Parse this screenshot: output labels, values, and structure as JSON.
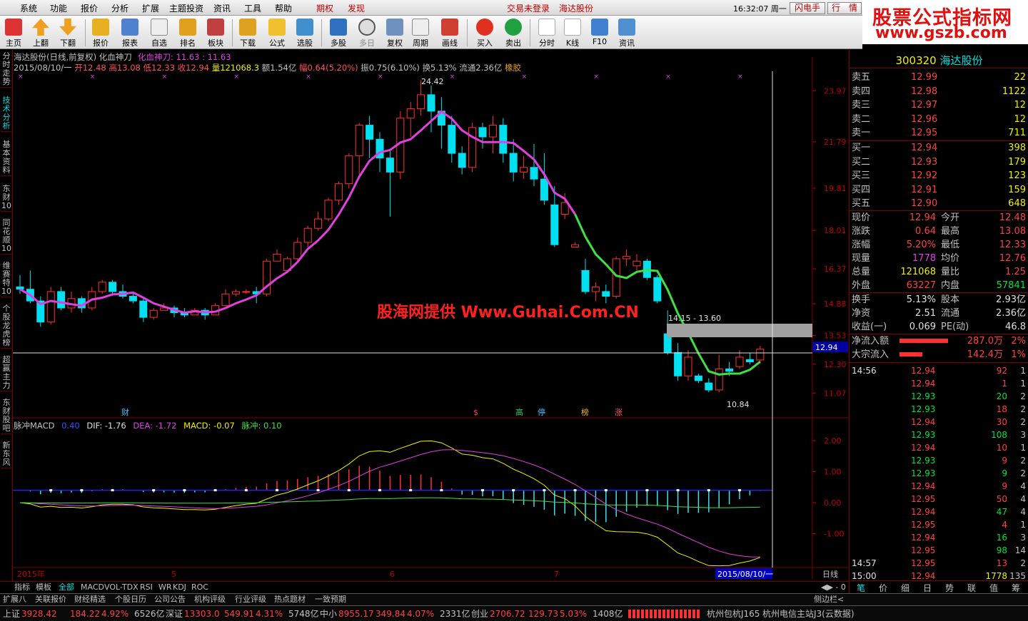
{
  "menu": {
    "items": [
      "系统",
      "功能",
      "报价",
      "分析",
      "扩展",
      "主题投资",
      "资讯",
      "工具",
      "帮助"
    ],
    "tags": [
      "期权",
      "发现"
    ],
    "center1": "交易未登录",
    "center2": "海达股份",
    "time": "16:32:07 周一",
    "btn1": "闪电手",
    "btn2": "行　情"
  },
  "brand": {
    "line1": "股票公式指标网",
    "line2": "www.gszb.com"
  },
  "toolbar": [
    "主页",
    "上翻",
    "下翻",
    "报价",
    "报表",
    "自选",
    "排名",
    "板块",
    "下载",
    "公式",
    "选股",
    "多股",
    "多日",
    "复权",
    "周期",
    "画线",
    "买入",
    "卖出",
    "分时",
    "K线",
    "F10",
    "资讯"
  ],
  "sidetabs": [
    "分时走势",
    "技术分析",
    "基本资料",
    "东财10",
    "同花顺10",
    "维赛特10",
    "个股龙虎榜",
    "超赢主力",
    "东财股吧",
    "新东风"
  ],
  "chart": {
    "title": "海达股份(日线,前复权) 化血神刀",
    "indicator": "化血神刀: 11.63 : 11.63",
    "info": {
      "date": "2015/08/10/一",
      "open": "开12.48",
      "high": "高13.08",
      "low": "低12.33",
      "close": "收12.94",
      "vol": "量121068.3",
      "amt": "额1.54亿",
      "pct": "幅0.64(5.20%)",
      "amp": "振0.75(6.10%)",
      "turn": "换5.13%",
      "float": "流通2.36亿",
      "label": "橡胶"
    },
    "yticks": [
      "23.97",
      "21.79",
      "19.81",
      "18.01",
      "16.37",
      "14.88",
      "13.53",
      "12.30",
      "11.07"
    ],
    "high_label": "24.42",
    "low_label": "10.84",
    "range_label": "14.15 - 13.60",
    "price_label": "12.94",
    "watermark": "股海网提供 Www.Guhai.Com.CN",
    "markers": [
      "财",
      "$",
      "高",
      "停",
      "榜",
      "涨"
    ],
    "macd": {
      "name": "脉冲MACD",
      "p": "0.40",
      "dif": "DIF: -1.76",
      "dea": "DEA: -1.72",
      "macd": "MACD: -0.07",
      "pulse": "脉冲: 0.10",
      "yticks": [
        "2.00",
        "1.00",
        "0.00",
        "-1.00"
      ]
    },
    "xaxis": {
      "labels": [
        "2015年",
        "5",
        "6",
        "7"
      ],
      "cursor": "2015/08/10/一",
      "period": "日线"
    },
    "subtabs": [
      "指标",
      "模板",
      "全部",
      "MACD",
      "VOL-TDX",
      "RSI",
      "WR",
      "KDJ",
      "ROC"
    ],
    "navtabs": [
      "扩展八",
      "关联报价",
      "财经精选",
      "个股日历",
      "公司公告",
      "机构评级",
      "行业评级",
      "热点题材",
      "一致预期"
    ],
    "sidebar_toggle": "侧边栏<"
  },
  "chart_data": {
    "type": "candlestick",
    "title": "海达股份(日线,前复权)",
    "ylim": [
      10.5,
      24.8
    ],
    "ohlc": [
      [
        15.6,
        16.1,
        15.3,
        15.5
      ],
      [
        15.5,
        16.3,
        14.9,
        15.0
      ],
      [
        15.0,
        15.2,
        13.9,
        14.1
      ],
      [
        14.1,
        15.6,
        14.0,
        15.4
      ],
      [
        15.4,
        15.6,
        14.6,
        14.7
      ],
      [
        14.7,
        15.4,
        14.5,
        15.1
      ],
      [
        15.1,
        15.2,
        14.5,
        14.7
      ],
      [
        14.7,
        15.6,
        14.6,
        15.4
      ],
      [
        15.4,
        15.9,
        15.3,
        15.8
      ],
      [
        15.8,
        15.9,
        15.3,
        15.4
      ],
      [
        15.4,
        15.7,
        15.1,
        15.2
      ],
      [
        15.2,
        15.4,
        14.9,
        15.0
      ],
      [
        15.0,
        15.1,
        14.1,
        14.3
      ],
      [
        14.3,
        14.7,
        14.2,
        14.6
      ],
      [
        14.6,
        14.9,
        14.6,
        14.7
      ],
      [
        14.7,
        14.8,
        14.3,
        14.5
      ],
      [
        14.5,
        14.7,
        14.3,
        14.4
      ],
      [
        14.4,
        14.7,
        14.4,
        14.6
      ],
      [
        14.6,
        14.7,
        14.2,
        14.4
      ],
      [
        14.4,
        14.9,
        14.4,
        14.8
      ],
      [
        14.8,
        15.5,
        14.8,
        15.3
      ],
      [
        15.3,
        15.5,
        15.2,
        15.4
      ],
      [
        15.4,
        15.5,
        15.3,
        15.4
      ],
      [
        15.4,
        15.6,
        14.9,
        15.3
      ],
      [
        15.3,
        16.8,
        15.2,
        16.7
      ],
      [
        16.7,
        17.2,
        16.8,
        17.0
      ],
      [
        16.3,
        16.9,
        16.2,
        16.8
      ],
      [
        16.8,
        17.7,
        16.6,
        17.5
      ],
      [
        17.5,
        18.2,
        17.3,
        18.1
      ],
      [
        18.1,
        18.8,
        18.0,
        18.5
      ],
      [
        18.5,
        19.4,
        18.4,
        19.3
      ],
      [
        19.3,
        20.1,
        19.1,
        20.0
      ],
      [
        20.0,
        21.3,
        19.8,
        21.2
      ],
      [
        21.2,
        22.6,
        20.3,
        22.5
      ],
      [
        22.5,
        22.9,
        21.1,
        21.9
      ],
      [
        21.9,
        22.2,
        20.5,
        21.1
      ],
      [
        21.1,
        21.5,
        18.6,
        20.5
      ],
      [
        20.5,
        23.1,
        20.2,
        22.8
      ],
      [
        22.8,
        23.5,
        22.0,
        23.2
      ],
      [
        23.2,
        24.42,
        22.9,
        23.8
      ],
      [
        23.8,
        24.2,
        22.2,
        23.1
      ],
      [
        23.1,
        23.7,
        21.5,
        22.5
      ],
      [
        22.5,
        22.9,
        20.9,
        21.3
      ],
      [
        21.3,
        21.6,
        20.4,
        20.7
      ],
      [
        20.7,
        22.6,
        20.5,
        22.4
      ],
      [
        22.4,
        22.6,
        21.5,
        22.0
      ],
      [
        22.0,
        22.9,
        21.3,
        22.5
      ],
      [
        22.5,
        22.8,
        20.9,
        21.3
      ],
      [
        21.3,
        21.9,
        20.1,
        20.5
      ],
      [
        20.5,
        21.2,
        20.2,
        20.7
      ],
      [
        20.7,
        21.7,
        19.9,
        20.2
      ],
      [
        20.2,
        21.3,
        19.1,
        19.3
      ],
      [
        19.1,
        19.9,
        17.3,
        17.4
      ],
      [
        18.7,
        19.6,
        18.5,
        19.2
      ],
      [
        17.3,
        17.5,
        17.3,
        17.4
      ],
      [
        16.3,
        16.8,
        15.3,
        15.4
      ],
      [
        15.4,
        15.8,
        15.0,
        15.6
      ],
      [
        15.4,
        15.7,
        14.9,
        15.2
      ],
      [
        15.2,
        16.9,
        15.1,
        16.8
      ],
      [
        16.8,
        17.2,
        16.5,
        16.9
      ],
      [
        16.5,
        17.0,
        16.3,
        16.7
      ],
      [
        16.7,
        16.8,
        15.9,
        16.0
      ],
      [
        16.0,
        16.1,
        14.9,
        15.0
      ],
      [
        13.6,
        14.6,
        12.7,
        12.8
      ],
      [
        12.8,
        13.2,
        11.6,
        11.8
      ],
      [
        11.8,
        12.9,
        11.6,
        12.6
      ],
      [
        11.8,
        11.9,
        11.5,
        11.6
      ],
      [
        11.5,
        11.7,
        11.1,
        11.2
      ],
      [
        11.2,
        12.7,
        11.1,
        12.1
      ],
      [
        12.1,
        12.4,
        11.8,
        12.0
      ],
      [
        12.2,
        12.9,
        12.1,
        12.6
      ],
      [
        12.5,
        12.8,
        12.3,
        12.4
      ],
      [
        12.48,
        13.08,
        12.33,
        12.94
      ]
    ],
    "indicator_line": "化血神刀",
    "macd": {
      "dif": -1.76,
      "dea": -1.72,
      "macd": -0.07,
      "pulse": 0.1,
      "ylim": [
        -2.0,
        2.3
      ]
    }
  },
  "quote": {
    "code": "300320",
    "name": "海达股份",
    "asks": [
      [
        "卖五",
        "12.99",
        "22"
      ],
      [
        "卖四",
        "12.98",
        "1122"
      ],
      [
        "卖三",
        "12.97",
        "12"
      ],
      [
        "卖二",
        "12.96",
        "12"
      ],
      [
        "卖一",
        "12.95",
        "711"
      ]
    ],
    "bids": [
      [
        "买一",
        "12.94",
        "398"
      ],
      [
        "买二",
        "12.93",
        "179"
      ],
      [
        "买三",
        "12.92",
        "123"
      ],
      [
        "买四",
        "12.91",
        "159"
      ],
      [
        "买五",
        "12.90",
        "648"
      ]
    ],
    "stats": [
      [
        "现价",
        "12.94",
        "今开",
        "12.48"
      ],
      [
        "涨跌",
        "0.64",
        "最高",
        "13.08"
      ],
      [
        "涨幅",
        "5.20%",
        "最低",
        "12.33"
      ],
      [
        "现量",
        "1778",
        "均价",
        "12.76"
      ],
      [
        "总量",
        "121068",
        "量比",
        "1.25"
      ],
      [
        "外盘",
        "63227",
        "内盘",
        "57841"
      ]
    ],
    "fin": [
      [
        "换手",
        "5.13%",
        "股本",
        "2.93亿"
      ],
      [
        "净资",
        "2.51",
        "流通",
        "2.36亿"
      ],
      [
        "收益(一)",
        "0.069",
        "PE(动)",
        "46.8"
      ]
    ],
    "flows": [
      [
        "净流入额",
        "287.0万",
        "2%"
      ],
      [
        "大宗流入",
        "142.4万",
        "1%"
      ]
    ],
    "ticks": [
      [
        "14:56",
        "12.94",
        "92",
        "1"
      ],
      [
        "",
        "12.94",
        "1",
        "1"
      ],
      [
        "",
        "12.93",
        "20",
        "2"
      ],
      [
        "",
        "12.93",
        "18",
        "2"
      ],
      [
        "",
        "12.94",
        "30",
        "2"
      ],
      [
        "",
        "12.93",
        "108",
        "3"
      ],
      [
        "",
        "12.94",
        "10",
        "1"
      ],
      [
        "",
        "12.93",
        "9",
        "2"
      ],
      [
        "",
        "12.93",
        "9",
        "2"
      ],
      [
        "",
        "12.94",
        "9",
        "4"
      ],
      [
        "",
        "12.95",
        "50",
        "4"
      ],
      [
        "",
        "12.94",
        "47",
        "4"
      ],
      [
        "",
        "12.95",
        "4",
        "1"
      ],
      [
        "",
        "12.94",
        "16",
        "3"
      ],
      [
        "",
        "12.95",
        "98",
        "14"
      ],
      [
        "14:57",
        "12.95",
        "13",
        "2"
      ],
      [
        "15:00",
        "12.94",
        "1778",
        "135"
      ]
    ],
    "tabs": [
      "笔",
      "价",
      "细",
      "日",
      "势",
      "联",
      "值",
      "筹"
    ]
  },
  "status": {
    "sh": "上证",
    "sh_v": "3928.42",
    "sh_c": "184.22",
    "sh_p": "4.92%",
    "sh_a": "6526亿",
    "sz": "深证",
    "sz_v": "13303.0",
    "sz_c": "549.91",
    "sz_p": "4.31%",
    "sz_a": "5748亿",
    "zx": "中小",
    "zx_v": "8955.17",
    "zx_c": "349.84",
    "zx_p": "4.07%",
    "zx_a": "2331亿",
    "cy": "创业",
    "cy_v": "2706.72",
    "cy_c": "129.73",
    "cy_p": "5.03%",
    "cy_a": "1408亿",
    "server": "杭州包杭J165",
    "server2": "杭州电信主站J3(云数据)"
  }
}
